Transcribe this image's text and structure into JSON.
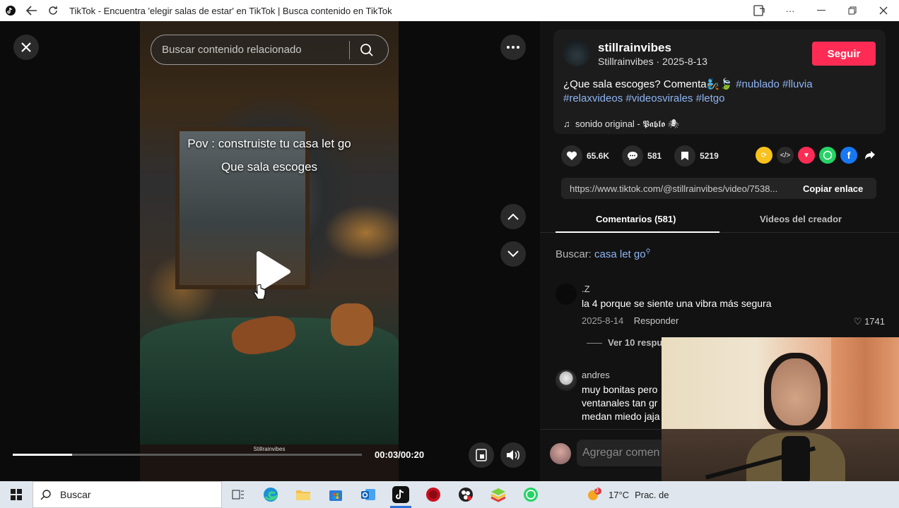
{
  "titlebar": {
    "title": "TikTok - Encuentra 'elegir salas de estar' en TikTok | Busca contenido en TikTok",
    "icons": [
      "tiktok-logo-icon",
      "back-arrow-icon",
      "refresh-icon",
      "app-install-icon",
      "more-icon",
      "minimize-icon",
      "restore-icon",
      "close-icon"
    ]
  },
  "player": {
    "search_placeholder": "Buscar contenido relacionado",
    "overlay_line1": "Pov : construiste tu casa let go",
    "overlay_line2": "Que sala escoges",
    "watermark": "Stillrainvibes",
    "time": "00:03/00:20",
    "progress": 0.17
  },
  "post": {
    "username": "stillrainvibes",
    "display_name": "Stillrainvibes",
    "date": "2025-8-13",
    "follow_label": "Seguir",
    "caption_text": "¿Que sala escoges? Comenta🧞🍃",
    "hashtags_line1": [
      "#nublado",
      "#lluvia"
    ],
    "hashtags_line2": [
      "#relaxvideos",
      "#videosvirales",
      "#letgo"
    ],
    "music": "sonido original - 𝕻𝖆𝖇𝖑𝖔 🕷"
  },
  "stats": {
    "likes": "65.6K",
    "comments": "581",
    "saves": "5219"
  },
  "share": {
    "url": "https://www.tiktok.com/@stillrainvibes/video/7538...",
    "copy_label": "Copiar enlace",
    "colors": {
      "repost": "#f7c21e",
      "embed": "#2a2a2a",
      "send": "#fe2c55",
      "whatsapp": "#25d366",
      "facebook": "#1877f2"
    }
  },
  "tabs": {
    "comments": "Comentarios (581)",
    "creator_videos": "Videos del creador"
  },
  "search_hint": {
    "prefix": "Buscar:",
    "keyword": "casa let go"
  },
  "comments": [
    {
      "user": ".Z",
      "text": "la 4 porque se siente una vibra más segura",
      "date": "2025-8-14",
      "reply_label": "Responder",
      "likes": "1741",
      "replies_label": "Ver 10 respu"
    },
    {
      "user": "andres",
      "text_line1": "muy bonitas pero",
      "text_line2": "ventanales tan gr",
      "text_line3": "medan miedo jaja"
    }
  ],
  "add_comment": {
    "placeholder": "Agregar comen"
  },
  "taskbar": {
    "search_label": "Buscar",
    "weather_temp": "17°C",
    "weather_text": "Prac. de",
    "weather_badge": "3",
    "apps": [
      "task-view-icon",
      "edge-icon",
      "file-explorer-icon",
      "store-icon",
      "outlook-icon",
      "tiktok-icon",
      "red-app-icon",
      "obs-icon",
      "bluestacks-icon",
      "whatsapp-icon"
    ]
  }
}
